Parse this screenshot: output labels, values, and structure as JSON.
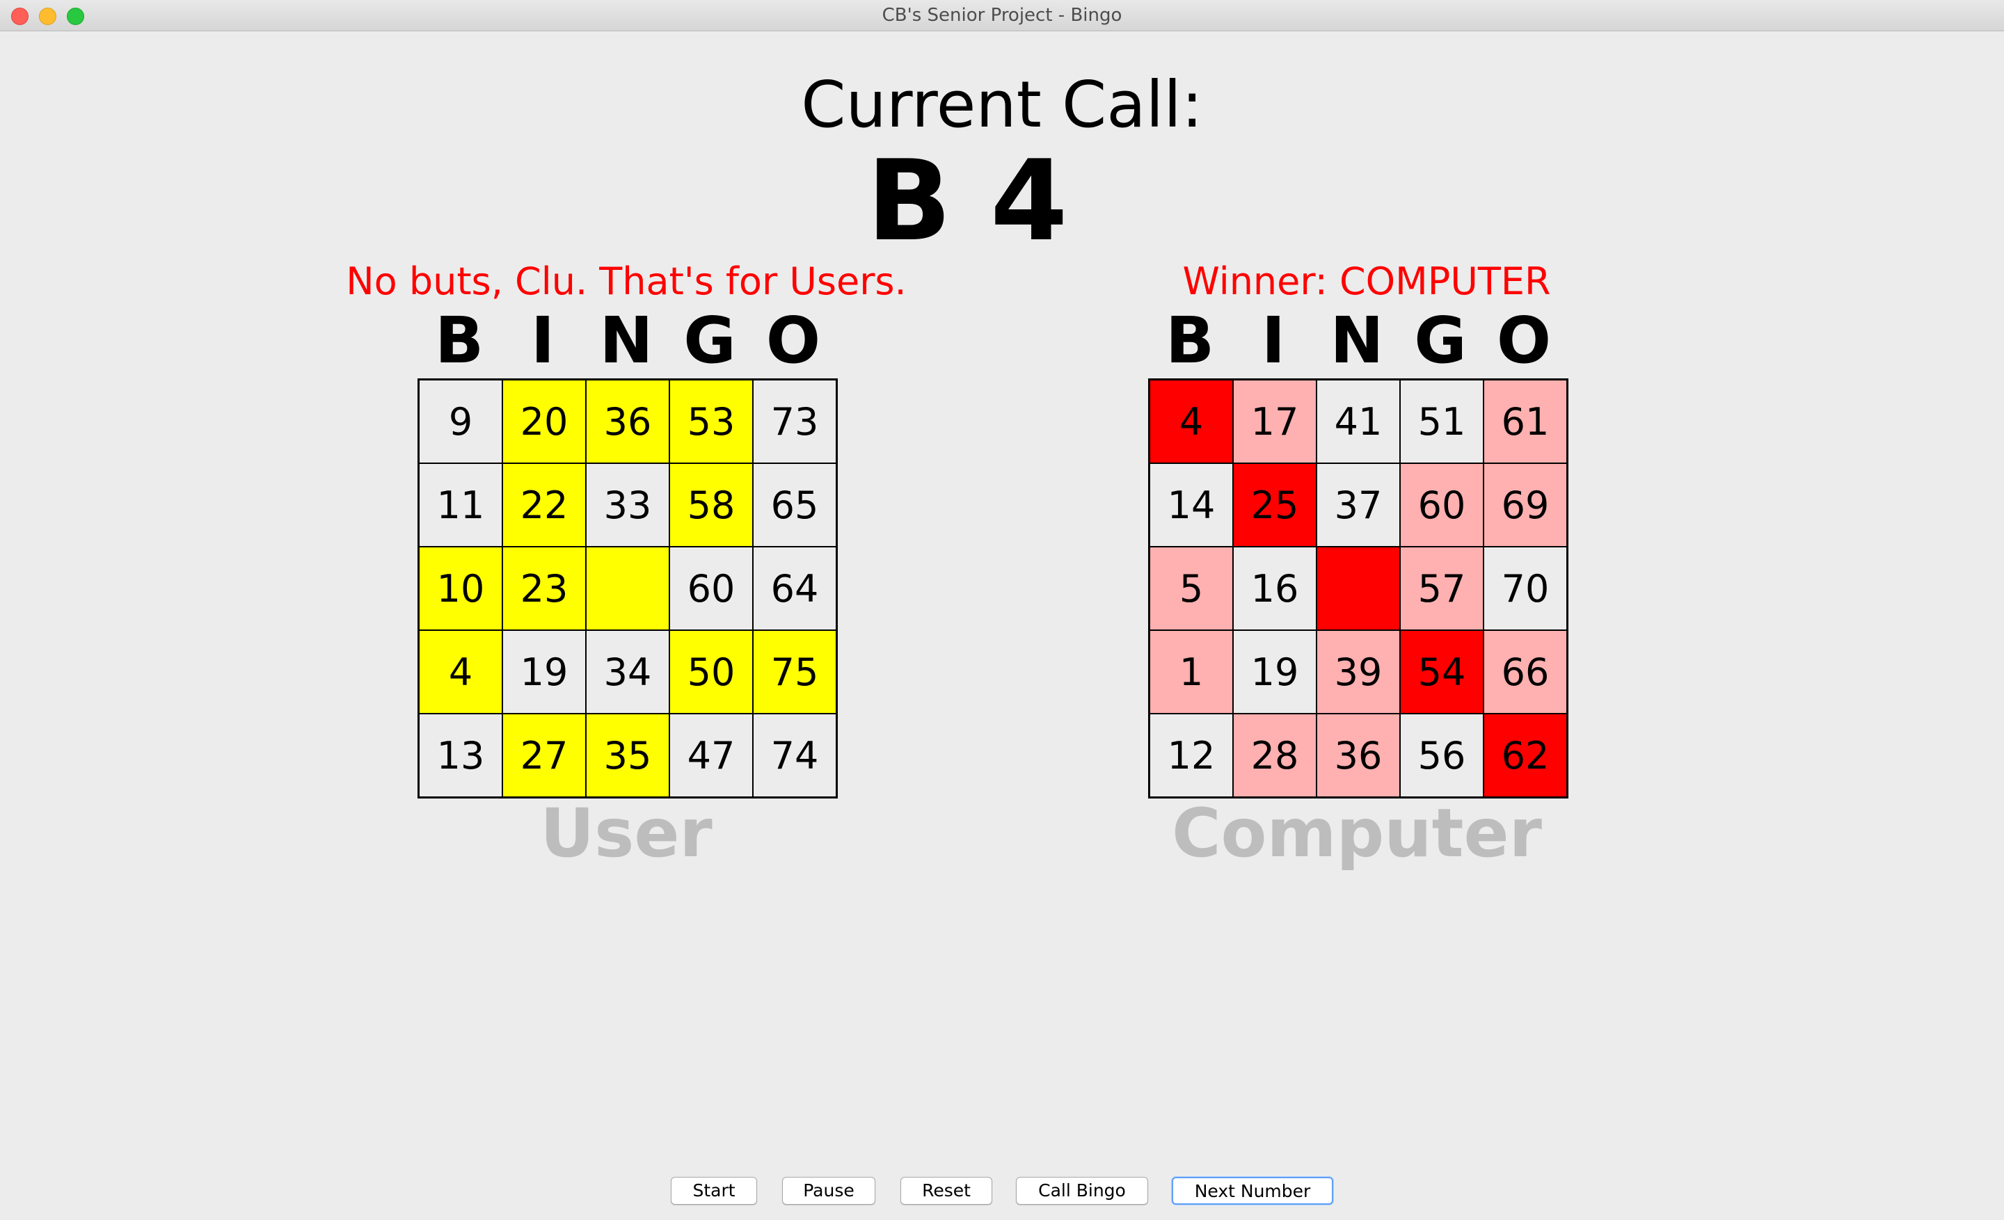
{
  "window": {
    "title": "CB's Senior Project - Bingo"
  },
  "call": {
    "label": "Current Call:",
    "value": "B 4"
  },
  "status": {
    "user_message": "No buts, Clu. That's for Users.",
    "computer_message": "Winner: COMPUTER"
  },
  "header_letters": [
    "B",
    "I",
    "N",
    "G",
    "O"
  ],
  "user_card": {
    "label": "User",
    "rows": [
      [
        {
          "n": "9",
          "m": ""
        },
        {
          "n": "20",
          "m": "user"
        },
        {
          "n": "36",
          "m": "user"
        },
        {
          "n": "53",
          "m": "user"
        },
        {
          "n": "73",
          "m": ""
        }
      ],
      [
        {
          "n": "11",
          "m": ""
        },
        {
          "n": "22",
          "m": "user"
        },
        {
          "n": "33",
          "m": ""
        },
        {
          "n": "58",
          "m": "user"
        },
        {
          "n": "65",
          "m": ""
        }
      ],
      [
        {
          "n": "10",
          "m": "user"
        },
        {
          "n": "23",
          "m": "user"
        },
        {
          "n": "",
          "m": "user"
        },
        {
          "n": "60",
          "m": ""
        },
        {
          "n": "64",
          "m": ""
        }
      ],
      [
        {
          "n": "4",
          "m": "user"
        },
        {
          "n": "19",
          "m": ""
        },
        {
          "n": "34",
          "m": ""
        },
        {
          "n": "50",
          "m": "user"
        },
        {
          "n": "75",
          "m": "user"
        }
      ],
      [
        {
          "n": "13",
          "m": ""
        },
        {
          "n": "27",
          "m": "user"
        },
        {
          "n": "35",
          "m": "user"
        },
        {
          "n": "47",
          "m": ""
        },
        {
          "n": "74",
          "m": ""
        }
      ]
    ]
  },
  "computer_card": {
    "label": "Computer",
    "rows": [
      [
        {
          "n": "4",
          "m": "win"
        },
        {
          "n": "17",
          "m": "light"
        },
        {
          "n": "41",
          "m": ""
        },
        {
          "n": "51",
          "m": ""
        },
        {
          "n": "61",
          "m": "light"
        }
      ],
      [
        {
          "n": "14",
          "m": ""
        },
        {
          "n": "25",
          "m": "win"
        },
        {
          "n": "37",
          "m": ""
        },
        {
          "n": "60",
          "m": "light"
        },
        {
          "n": "69",
          "m": "light"
        }
      ],
      [
        {
          "n": "5",
          "m": "light"
        },
        {
          "n": "16",
          "m": ""
        },
        {
          "n": "",
          "m": "win"
        },
        {
          "n": "57",
          "m": "light"
        },
        {
          "n": "70",
          "m": ""
        }
      ],
      [
        {
          "n": "1",
          "m": "light"
        },
        {
          "n": "19",
          "m": ""
        },
        {
          "n": "39",
          "m": "light"
        },
        {
          "n": "54",
          "m": "win"
        },
        {
          "n": "66",
          "m": "light"
        }
      ],
      [
        {
          "n": "12",
          "m": ""
        },
        {
          "n": "28",
          "m": "light"
        },
        {
          "n": "36",
          "m": "light"
        },
        {
          "n": "56",
          "m": ""
        },
        {
          "n": "62",
          "m": "win"
        }
      ]
    ]
  },
  "colors": {
    "user_marked": "#ffff00",
    "computer_marked": "#ffb0b0",
    "computer_winning_line": "#ff0000",
    "status_text": "#ff0000",
    "card_label": "#bdbdbd"
  },
  "buttons": {
    "start": "Start",
    "pause": "Pause",
    "reset": "Reset",
    "call_bingo": "Call Bingo",
    "next_number": "Next Number"
  }
}
